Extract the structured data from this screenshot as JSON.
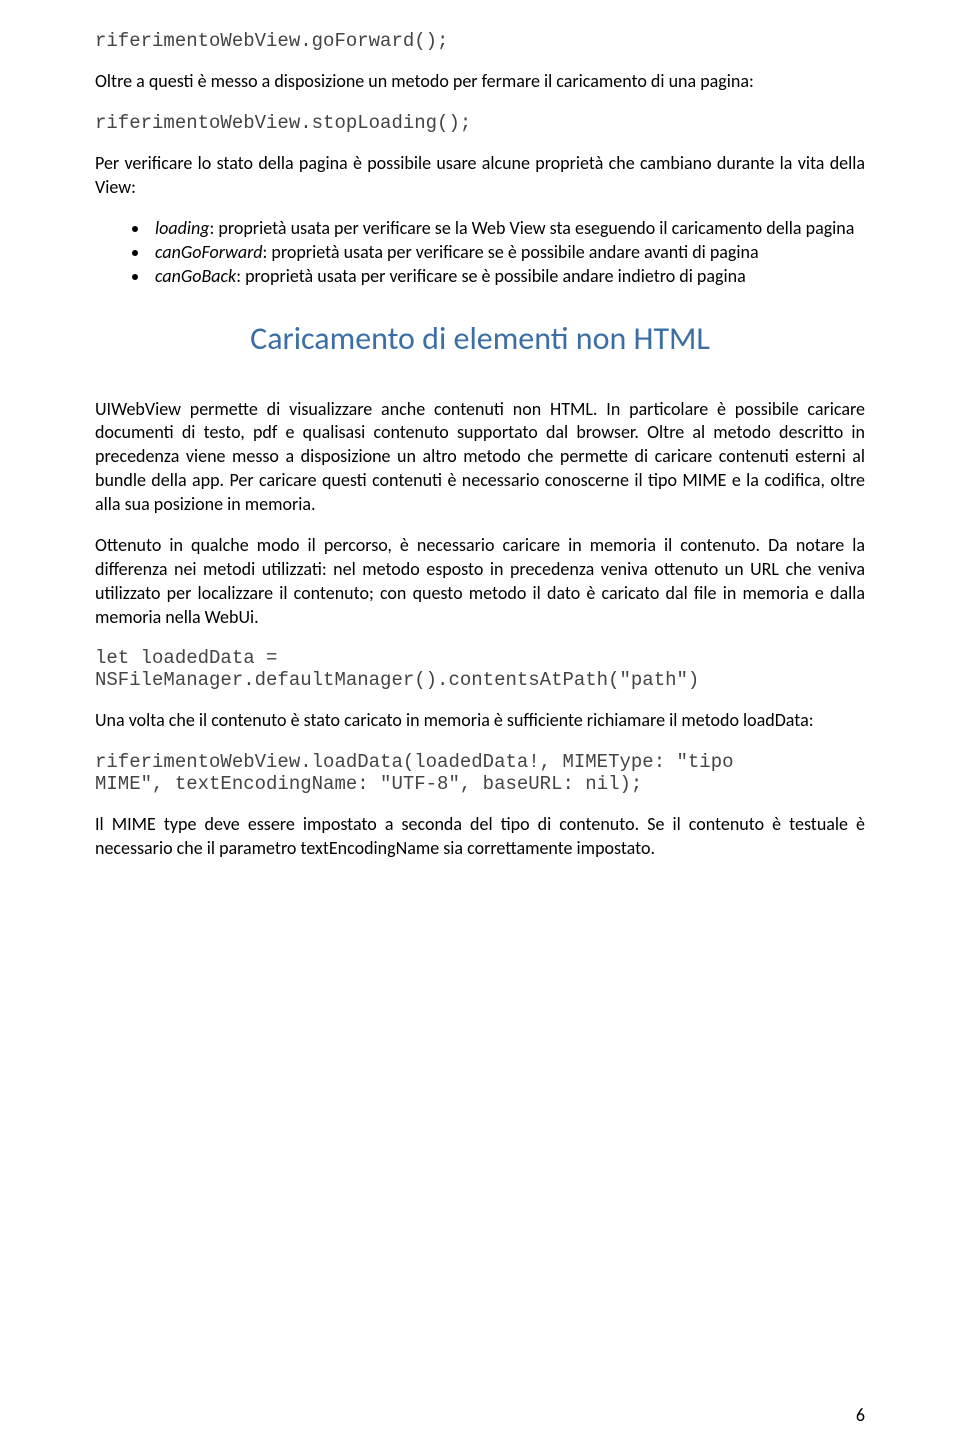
{
  "code1": "riferimentoWebView.goForward();",
  "para1": "Oltre a questi è messo a disposizione un metodo per fermare il caricamento di una pagina:",
  "code2": "riferimentoWebView.stopLoading();",
  "para2": "Per verificare lo stato della pagina è possibile usare alcune proprietà che cambiano durante la vita della View:",
  "bullets": [
    {
      "term": "loading",
      "desc": ": proprietà usata per verificare se la Web View sta eseguendo il caricamento della pagina"
    },
    {
      "term": "canGoForward",
      "desc": ": proprietà usata per verificare se è possibile andare avanti di pagina"
    },
    {
      "term": "canGoBack",
      "desc": ": proprietà usata per verificare se è possibile andare indietro di pagina"
    }
  ],
  "heading": "Caricamento di elementi non HTML",
  "para3": "UIWebView permette di visualizzare anche contenuti non HTML. In particolare è possibile caricare documenti di testo, pdf e qualisasi contenuto supportato dal browser. Oltre al metodo descritto in precedenza viene messo a disposizione un altro metodo che permette di caricare contenuti esterni al bundle della app. Per caricare questi contenuti è necessario conoscerne il tipo MIME e la codifica, oltre alla sua posizione in memoria.",
  "para4": "Ottenuto in qualche modo il percorso, è necessario caricare in memoria il contenuto. Da notare la differenza nei metodi utilizzati: nel metodo esposto in precedenza veniva ottenuto un URL che veniva utilizzato per localizzare il contenuto; con questo metodo il dato è caricato dal file in memoria e dalla memoria nella WebUi.",
  "code3a": "let loadedData =",
  "code3b": "NSFileManager.defaultManager().contentsAtPath(\"path\")",
  "para5": "Una volta che il contenuto è stato caricato in memoria è sufficiente richiamare il metodo loadData:",
  "code4a": "riferimentoWebView.loadData(loadedData!, MIMEType: \"tipo",
  "code4b": "MIME\", textEncodingName: \"UTF-8\", baseURL: nil);",
  "para6": "Il MIME type deve essere impostato a seconda del tipo di contenuto. Se il contenuto è testuale è necessario che il parametro textEncodingName sia correttamente impostato.",
  "pageNumber": "6"
}
